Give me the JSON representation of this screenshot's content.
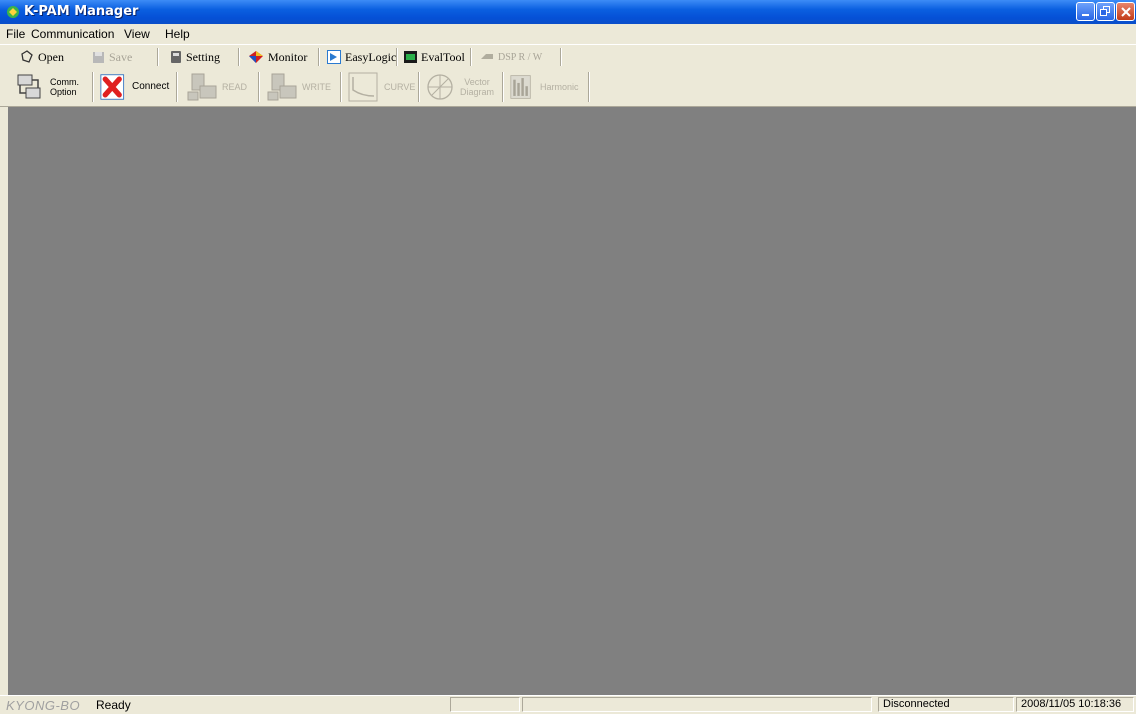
{
  "window": {
    "title": "K-PAM Manager"
  },
  "menu": {
    "file": "File",
    "communication": "Communication",
    "view": "View",
    "help": "Help"
  },
  "toolbar1": {
    "open": "Open",
    "save": "Save",
    "setting": "Setting",
    "monitor": "Monitor",
    "easylogic": "EasyLogic",
    "evaltool": "EvalTool",
    "dsp": "DSP R / W"
  },
  "toolbar2": {
    "comm_option_1": "Comm.",
    "comm_option_2": "Option",
    "connect": "Connect",
    "read": "READ",
    "write": "WRITE",
    "curve": "CURVE",
    "vector_1": "Vector",
    "vector_2": "Diagram",
    "harmonic": "Harmonic"
  },
  "status": {
    "logo": "KYONG-BO",
    "text": "Ready",
    "connection": "Disconnected",
    "datetime": "2008/11/05 10:18:36"
  },
  "colors": {
    "title_bar": "#0a5fe0",
    "workspace": "#808080",
    "chrome": "#ece9d8"
  },
  "icons": [
    "app-icon",
    "minimize-icon",
    "restore-icon",
    "close-icon",
    "open-icon",
    "save-icon",
    "setting-icon",
    "monitor-icon",
    "easylogic-icon",
    "evaltool-icon",
    "dsp-icon",
    "comm-option-icon",
    "connect-icon",
    "read-icon",
    "write-icon",
    "curve-icon",
    "vector-diagram-icon",
    "harmonic-icon"
  ]
}
